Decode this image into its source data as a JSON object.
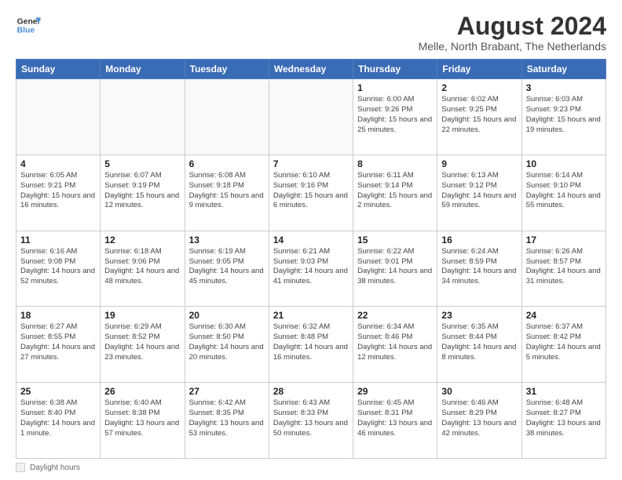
{
  "header": {
    "logo_line1": "General",
    "logo_line2": "Blue",
    "main_title": "August 2024",
    "subtitle": "Melle, North Brabant, The Netherlands"
  },
  "weekdays": [
    "Sunday",
    "Monday",
    "Tuesday",
    "Wednesday",
    "Thursday",
    "Friday",
    "Saturday"
  ],
  "footer": {
    "label": "Daylight hours"
  },
  "weeks": [
    [
      {
        "day": "",
        "empty": true
      },
      {
        "day": "",
        "empty": true
      },
      {
        "day": "",
        "empty": true
      },
      {
        "day": "",
        "empty": true
      },
      {
        "day": "1",
        "sunrise": "6:00 AM",
        "sunset": "9:26 PM",
        "daylight": "15 hours and 25 minutes."
      },
      {
        "day": "2",
        "sunrise": "6:02 AM",
        "sunset": "9:25 PM",
        "daylight": "15 hours and 22 minutes."
      },
      {
        "day": "3",
        "sunrise": "6:03 AM",
        "sunset": "9:23 PM",
        "daylight": "15 hours and 19 minutes."
      }
    ],
    [
      {
        "day": "4",
        "sunrise": "6:05 AM",
        "sunset": "9:21 PM",
        "daylight": "15 hours and 16 minutes."
      },
      {
        "day": "5",
        "sunrise": "6:07 AM",
        "sunset": "9:19 PM",
        "daylight": "15 hours and 12 minutes."
      },
      {
        "day": "6",
        "sunrise": "6:08 AM",
        "sunset": "9:18 PM",
        "daylight": "15 hours and 9 minutes."
      },
      {
        "day": "7",
        "sunrise": "6:10 AM",
        "sunset": "9:16 PM",
        "daylight": "15 hours and 6 minutes."
      },
      {
        "day": "8",
        "sunrise": "6:11 AM",
        "sunset": "9:14 PM",
        "daylight": "15 hours and 2 minutes."
      },
      {
        "day": "9",
        "sunrise": "6:13 AM",
        "sunset": "9:12 PM",
        "daylight": "14 hours and 59 minutes."
      },
      {
        "day": "10",
        "sunrise": "6:14 AM",
        "sunset": "9:10 PM",
        "daylight": "14 hours and 55 minutes."
      }
    ],
    [
      {
        "day": "11",
        "sunrise": "6:16 AM",
        "sunset": "9:08 PM",
        "daylight": "14 hours and 52 minutes."
      },
      {
        "day": "12",
        "sunrise": "6:18 AM",
        "sunset": "9:06 PM",
        "daylight": "14 hours and 48 minutes."
      },
      {
        "day": "13",
        "sunrise": "6:19 AM",
        "sunset": "9:05 PM",
        "daylight": "14 hours and 45 minutes."
      },
      {
        "day": "14",
        "sunrise": "6:21 AM",
        "sunset": "9:03 PM",
        "daylight": "14 hours and 41 minutes."
      },
      {
        "day": "15",
        "sunrise": "6:22 AM",
        "sunset": "9:01 PM",
        "daylight": "14 hours and 38 minutes."
      },
      {
        "day": "16",
        "sunrise": "6:24 AM",
        "sunset": "8:59 PM",
        "daylight": "14 hours and 34 minutes."
      },
      {
        "day": "17",
        "sunrise": "6:26 AM",
        "sunset": "8:57 PM",
        "daylight": "14 hours and 31 minutes."
      }
    ],
    [
      {
        "day": "18",
        "sunrise": "6:27 AM",
        "sunset": "8:55 PM",
        "daylight": "14 hours and 27 minutes."
      },
      {
        "day": "19",
        "sunrise": "6:29 AM",
        "sunset": "8:52 PM",
        "daylight": "14 hours and 23 minutes."
      },
      {
        "day": "20",
        "sunrise": "6:30 AM",
        "sunset": "8:50 PM",
        "daylight": "14 hours and 20 minutes."
      },
      {
        "day": "21",
        "sunrise": "6:32 AM",
        "sunset": "8:48 PM",
        "daylight": "14 hours and 16 minutes."
      },
      {
        "day": "22",
        "sunrise": "6:34 AM",
        "sunset": "8:46 PM",
        "daylight": "14 hours and 12 minutes."
      },
      {
        "day": "23",
        "sunrise": "6:35 AM",
        "sunset": "8:44 PM",
        "daylight": "14 hours and 8 minutes."
      },
      {
        "day": "24",
        "sunrise": "6:37 AM",
        "sunset": "8:42 PM",
        "daylight": "14 hours and 5 minutes."
      }
    ],
    [
      {
        "day": "25",
        "sunrise": "6:38 AM",
        "sunset": "8:40 PM",
        "daylight": "14 hours and 1 minute."
      },
      {
        "day": "26",
        "sunrise": "6:40 AM",
        "sunset": "8:38 PM",
        "daylight": "13 hours and 57 minutes."
      },
      {
        "day": "27",
        "sunrise": "6:42 AM",
        "sunset": "8:35 PM",
        "daylight": "13 hours and 53 minutes."
      },
      {
        "day": "28",
        "sunrise": "6:43 AM",
        "sunset": "8:33 PM",
        "daylight": "13 hours and 50 minutes."
      },
      {
        "day": "29",
        "sunrise": "6:45 AM",
        "sunset": "8:31 PM",
        "daylight": "13 hours and 46 minutes."
      },
      {
        "day": "30",
        "sunrise": "6:46 AM",
        "sunset": "8:29 PM",
        "daylight": "13 hours and 42 minutes."
      },
      {
        "day": "31",
        "sunrise": "6:48 AM",
        "sunset": "8:27 PM",
        "daylight": "13 hours and 38 minutes."
      }
    ]
  ]
}
